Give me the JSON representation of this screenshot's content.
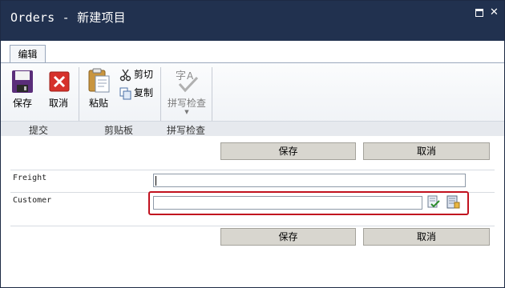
{
  "window": {
    "title": "Orders - 新建项目"
  },
  "ribbon": {
    "active_tab": "编辑",
    "groups": {
      "commit": {
        "label": "提交",
        "save": "保存",
        "cancel": "取消"
      },
      "clipboard": {
        "label": "剪贴板",
        "paste": "粘贴",
        "cut": "剪切",
        "copy": "复制"
      },
      "spelling": {
        "label": "拼写检查",
        "spellcheck": "拼写检查"
      }
    }
  },
  "form": {
    "save_label": "保存",
    "cancel_label": "取消",
    "fields": [
      {
        "label": "Freight",
        "value": ""
      },
      {
        "label": "Customer",
        "value": ""
      }
    ]
  },
  "icons": {
    "save": "floppy-disk-icon",
    "cancel": "red-x-icon",
    "paste": "clipboard-icon",
    "cut": "scissors-icon",
    "copy": "copy-icon",
    "spellcheck": "spellcheck-icon",
    "check_names": "check-names-icon",
    "browse": "address-book-icon"
  },
  "colors": {
    "titlebar": "#21314f",
    "highlight": "#c1121f",
    "button_face": "#d8d6cf"
  }
}
